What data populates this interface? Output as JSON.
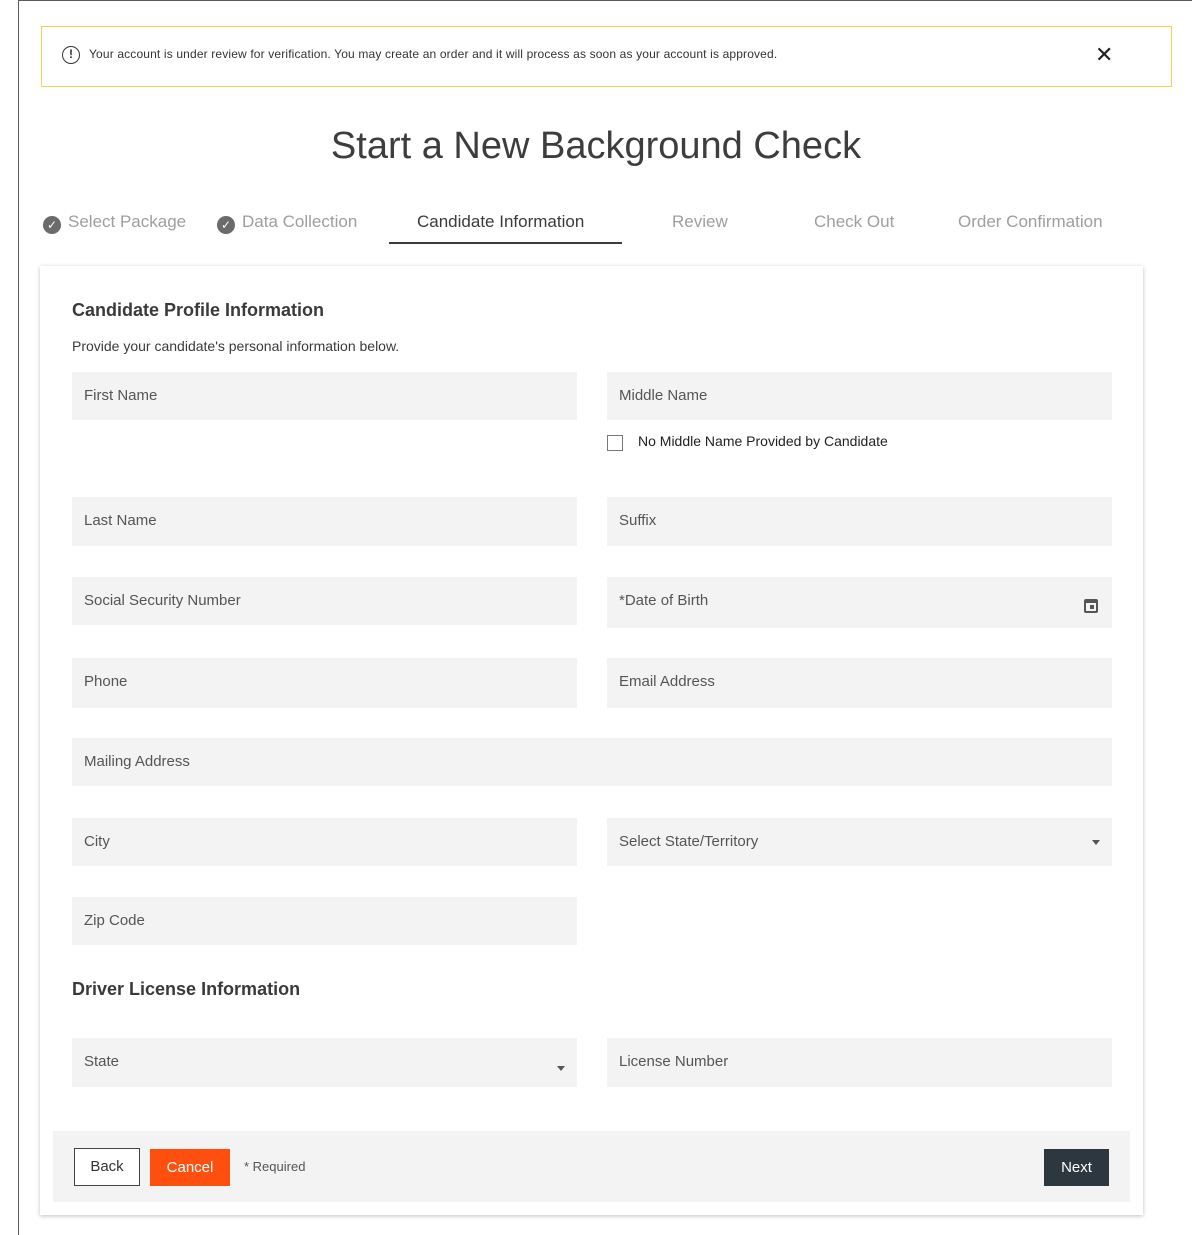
{
  "alert": {
    "icon": "info-circle-icon",
    "text": "Your account is under review for verification. You may create an order and it will process as soon as your account is approved.",
    "close_symbol": "✕",
    "border_color": "#f2d34d"
  },
  "page_title": "Start a New Background Check",
  "steps": [
    {
      "label": "Select Package",
      "state": "done"
    },
    {
      "label": "Data Collection",
      "state": "done"
    },
    {
      "label": "Candidate Information",
      "state": "active"
    },
    {
      "label": "Review",
      "state": "pending"
    },
    {
      "label": "Check Out",
      "state": "pending"
    },
    {
      "label": "Order Confirmation",
      "state": "pending"
    }
  ],
  "profile": {
    "title": "Candidate Profile Information",
    "subtitle": "Provide your candidate's personal information below.",
    "fields": {
      "first_name": "First Name",
      "middle_name": "Middle Name",
      "no_middle": "No Middle Name Provided by Candidate",
      "last_name": "Last Name",
      "suffix": "Suffix",
      "ssn": "Social Security Number",
      "dob": "*Date of Birth",
      "phone": "Phone",
      "email": "Email Address",
      "mailing": "Mailing Address",
      "city": "City",
      "state_territory": "Select State/Territory",
      "zip": "Zip Code"
    }
  },
  "license": {
    "title": "Driver License Information",
    "state": "State",
    "number": "License Number"
  },
  "footer": {
    "back": "Back",
    "cancel": "Cancel",
    "required": "* Required",
    "next": "Next"
  },
  "colors": {
    "cancel": "#ff4f0f",
    "next": "#2c3740",
    "field_bg": "#f3f3f3"
  }
}
